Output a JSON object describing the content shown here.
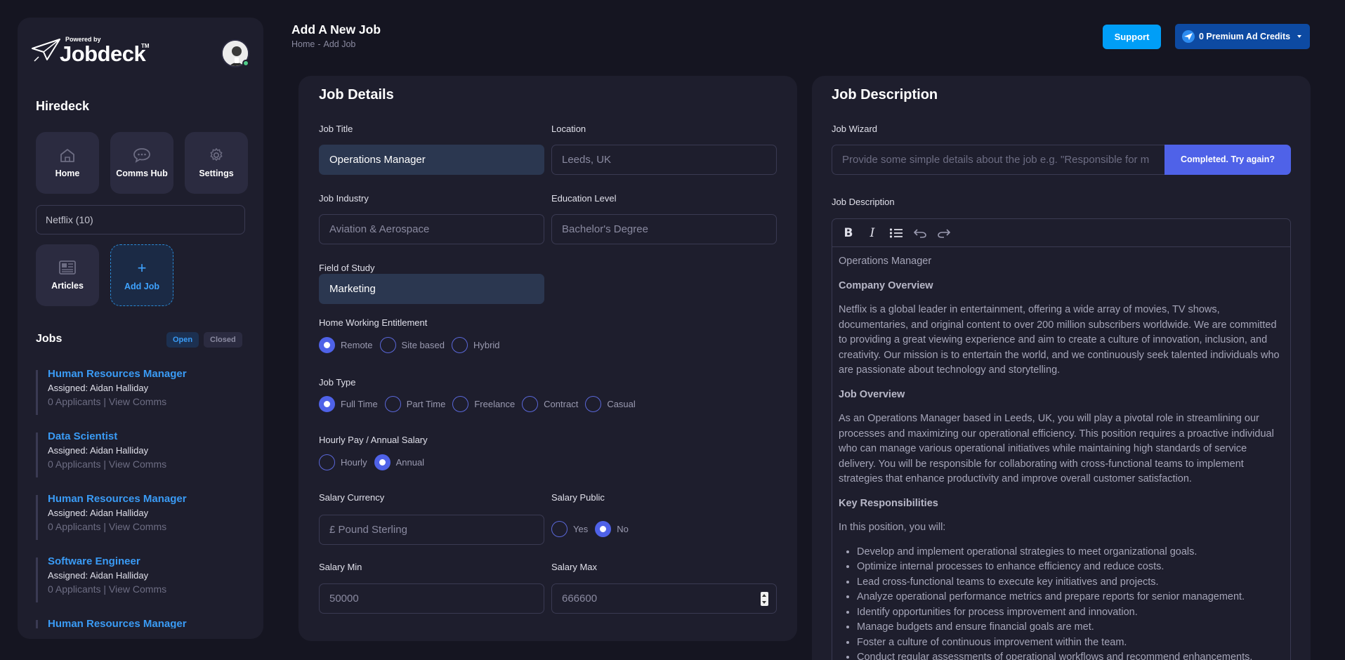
{
  "sidebar": {
    "logo": {
      "powered": "Powered by",
      "word": "Jobdeck",
      "tm": "TM"
    },
    "company": "Hiredeck",
    "tiles": [
      {
        "label": "Home",
        "icon": "home-icon"
      },
      {
        "label": "Comms Hub",
        "icon": "chat-icon"
      },
      {
        "label": "Settings",
        "icon": "gear-icon"
      },
      {
        "label": "Articles",
        "icon": "newspaper-icon"
      },
      {
        "label": "Add Job",
        "icon": "plus-icon"
      }
    ],
    "company_select": "Netflix  (10)",
    "jobs_heading": "Jobs",
    "filter_open": "Open",
    "filter_closed": "Closed",
    "jobs": [
      {
        "title": "Human Resources Manager",
        "assigned": "Assigned: Aidan Halliday",
        "applicants": "0 Applicants",
        "sep": "|",
        "view": "View Comms"
      },
      {
        "title": "Data Scientist",
        "assigned": "Assigned: Aidan Halliday",
        "applicants": "0 Applicants",
        "sep": "|",
        "view": "View Comms"
      },
      {
        "title": "Human Resources Manager",
        "assigned": "Assigned: Aidan Halliday",
        "applicants": "0 Applicants",
        "sep": "|",
        "view": "View Comms"
      },
      {
        "title": "Software Engineer",
        "assigned": "Assigned: Aidan Halliday",
        "applicants": "0 Applicants",
        "sep": "|",
        "view": "View Comms"
      },
      {
        "title": "Human Resources Manager",
        "assigned": "",
        "applicants": "",
        "sep": "",
        "view": ""
      }
    ]
  },
  "header": {
    "title": "Add A New Job",
    "crumbs": [
      "Home",
      "-",
      "Add Job"
    ],
    "support": "Support",
    "credits": "0 Premium Ad Credits"
  },
  "job_details": {
    "title": "Job Details",
    "job_title_label": "Job Title",
    "job_title_value": "Operations Manager",
    "location_label": "Location",
    "location_placeholder": "Leeds, UK",
    "industry_label": "Job Industry",
    "industry_placeholder": "Aviation & Aerospace",
    "education_label": "Education Level",
    "education_placeholder": "Bachelor's Degree",
    "field_label": "Field of Study",
    "field_value": "Marketing",
    "home_label": "Home Working Entitlement",
    "home_options": [
      "Remote",
      "Site based",
      "Hybrid"
    ],
    "home_selected": "Remote",
    "type_label": "Job Type",
    "type_options": [
      "Full Time",
      "Part Time",
      "Freelance",
      "Contract",
      "Casual"
    ],
    "type_selected": "Full Time",
    "pay_label": "Hourly Pay / Annual Salary",
    "pay_options": [
      "Hourly",
      "Annual"
    ],
    "pay_selected": "Annual",
    "currency_label": "Salary Currency",
    "currency_placeholder": "£ Pound Sterling",
    "public_label": "Salary Public",
    "public_options": [
      "Yes",
      "No"
    ],
    "public_selected": "No",
    "min_label": "Salary Min",
    "min_placeholder": "50000",
    "max_label": "Salary Max",
    "max_value": "666600"
  },
  "job_description": {
    "title": "Job Description",
    "wizard_label": "Job Wizard",
    "wizard_placeholder": "Provide some simple details about the job e.g. \"Responsible for m",
    "wizard_button": "Completed. Try again?",
    "desc_label": "Job Description",
    "content": {
      "heading_line": "Operations Manager",
      "company_overview_heading": "Company Overview",
      "company_overview": "Netflix is a global leader in entertainment, offering a wide array of movies, TV shows, documentaries, and original content to over 200 million subscribers worldwide. We are committed to providing a great viewing experience and aim to create a culture of innovation, inclusion, and creativity. Our mission is to entertain the world, and we continuously seek talented individuals who are passionate about technology and storytelling.",
      "job_overview_heading": "Job Overview",
      "job_overview": "As an Operations Manager based in Leeds, UK, you will play a pivotal role in streamlining our processes and maximizing our operational efficiency. This position requires a proactive individual who can manage various operational initiatives while maintaining high standards of service delivery. You will be responsible for collaborating with cross-functional teams to implement strategies that enhance productivity and improve overall customer satisfaction.",
      "key_heading": "Key Responsibilities",
      "key_intro": "In this position, you will:",
      "responsibilities": [
        "Develop and implement operational strategies to meet organizational goals.",
        "Optimize internal processes to enhance efficiency and reduce costs.",
        "Lead cross-functional teams to execute key initiatives and projects.",
        "Analyze operational performance metrics and prepare reports for senior management.",
        "Identify opportunities for process improvement and innovation.",
        "Manage budgets and ensure financial goals are met.",
        "Foster a culture of continuous improvement within the team.",
        "Conduct regular assessments of operational workflows and recommend enhancements."
      ]
    }
  },
  "colors": {
    "background": "#151521",
    "card": "#1e1e2d",
    "accent": "#4f62e8",
    "link": "#3a9bf5",
    "support": "#009ef7",
    "credits": "#0d4aa2"
  }
}
